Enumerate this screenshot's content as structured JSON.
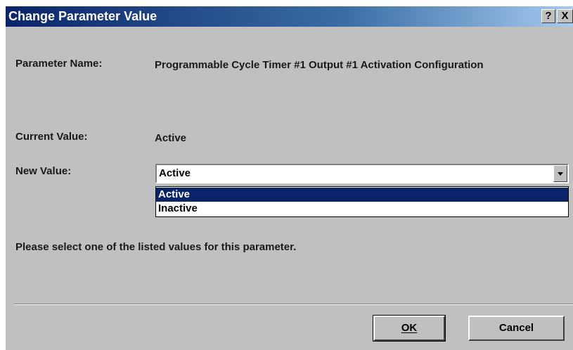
{
  "dialog": {
    "title": "Change Parameter Value",
    "help_button": "?",
    "close_button": "X"
  },
  "fields": {
    "parameter_name_label": "Parameter Name:",
    "parameter_name_value": "Programmable Cycle Timer #1 Output #1 Activation Configuration",
    "current_value_label": "Current Value:",
    "current_value_value": "Active",
    "new_value_label": "New Value:"
  },
  "new_value_select": {
    "selected": "Active",
    "options": [
      "Active",
      "Inactive"
    ],
    "highlighted_index": 0
  },
  "instruction": "Please select one of the listed values for this parameter.",
  "buttons": {
    "ok_label": "OK",
    "cancel_label": "Cancel"
  },
  "colors": {
    "titlebar_start": "#0a246a",
    "titlebar_end": "#a6caf0",
    "dialog_bg": "#c0c0c0",
    "selection_bg": "#0a246a"
  }
}
